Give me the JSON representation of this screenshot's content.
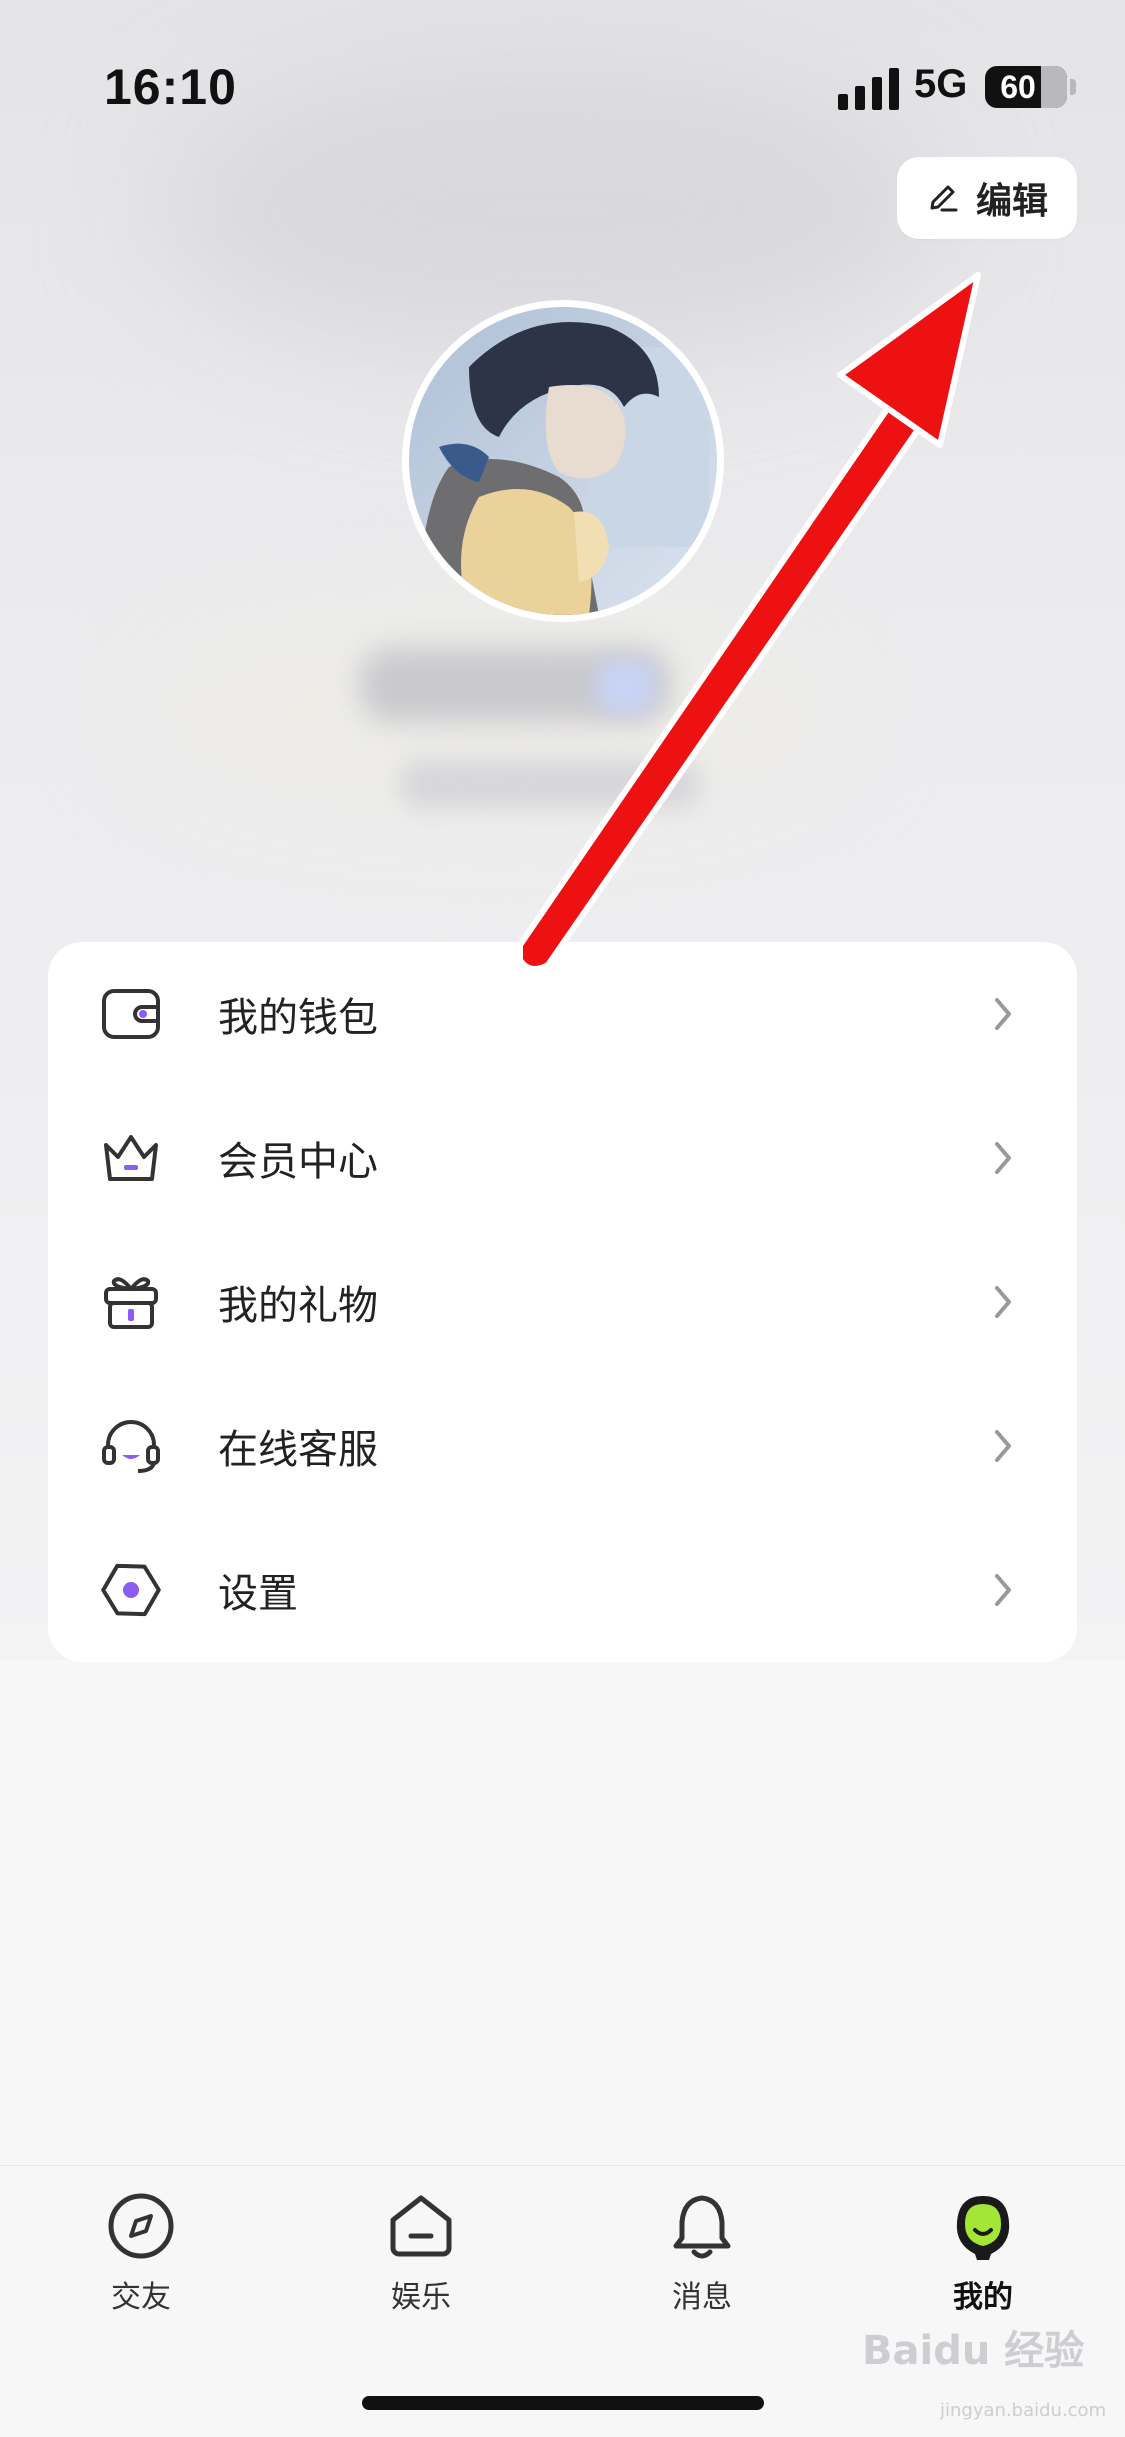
{
  "status_bar": {
    "time": "16:10",
    "network": "5G",
    "battery": "60"
  },
  "header": {
    "edit_label": "编辑",
    "accent_color": "#8b5cf6"
  },
  "menu": {
    "items": [
      {
        "label": "我的钱包",
        "icon": "wallet-icon"
      },
      {
        "label": "会员中心",
        "icon": "crown-icon"
      },
      {
        "label": "我的礼物",
        "icon": "gift-icon"
      },
      {
        "label": "在线客服",
        "icon": "headset-icon"
      },
      {
        "label": "设置",
        "icon": "settings-icon"
      }
    ]
  },
  "tabbar": {
    "tabs": [
      {
        "label": "交友",
        "icon": "compass-icon"
      },
      {
        "label": "娱乐",
        "icon": "home-icon"
      },
      {
        "label": "消息",
        "icon": "bell-icon"
      },
      {
        "label": "我的",
        "icon": "profile-avatar-icon",
        "active": true
      }
    ]
  },
  "watermark": {
    "text": "Baidu 经验",
    "url": "jingyan.baidu.com"
  }
}
